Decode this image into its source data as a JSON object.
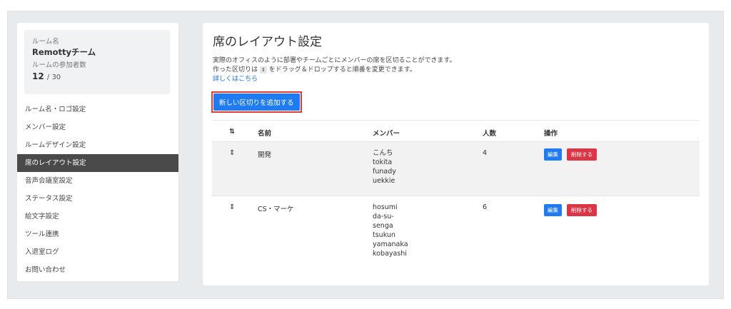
{
  "sidebar": {
    "room_name_label": "ルーム名",
    "room_name": "Remottyチーム",
    "member_count_label": "ルームの参加者数",
    "member_count": "12",
    "member_max": "/ 30",
    "items": [
      {
        "label": "ルーム名・ロゴ設定"
      },
      {
        "label": "メンバー設定"
      },
      {
        "label": "ルームデザイン設定"
      },
      {
        "label": "席のレイアウト設定"
      },
      {
        "label": "音声会議室設定"
      },
      {
        "label": "ステータス設定"
      },
      {
        "label": "絵文字設定"
      },
      {
        "label": "ツール連携"
      },
      {
        "label": "入退室ログ"
      },
      {
        "label": "お問い合わせ"
      }
    ]
  },
  "main": {
    "title": "席のレイアウト設定",
    "desc_line1": "実際のオフィスのように部署やチームごとにメンバーの席を区切ることができます。",
    "desc_line2_a": "作った区切りは",
    "desc_line2_icon": "⇕",
    "desc_line2_b": "をドラッグ＆ドロップすると順番を変更できます。",
    "help_link": "詳しくはこちら",
    "add_button": "新しい区切りを追加する"
  },
  "table": {
    "headers": {
      "sort": "⇅",
      "name": "名前",
      "members": "メンバー",
      "count": "人数",
      "actions": "操作"
    },
    "rows": [
      {
        "drag": "⇕",
        "name": "開発",
        "m0": "こんち",
        "m1": "tokita",
        "m2": "funady",
        "m3": "uekkie",
        "count": "4",
        "edit": "編集",
        "delete": "削除する"
      },
      {
        "drag": "⇕",
        "name": "CS・マーケ",
        "m0": "hosumi",
        "m1": "da-su-",
        "m2": "senga",
        "m3": "tsukun",
        "m4": "yamanaka",
        "m5": "kobayashi",
        "count": "6",
        "edit": "編集",
        "delete": "削除する"
      }
    ]
  },
  "colors": {
    "accent": "#1e7bf2",
    "danger": "#dc3545",
    "highlight_border": "#e53935",
    "active_nav": "#4a4a4a"
  },
  "icons": {
    "drag_handle": "drag-handle-icon",
    "sort": "sort-icon"
  }
}
